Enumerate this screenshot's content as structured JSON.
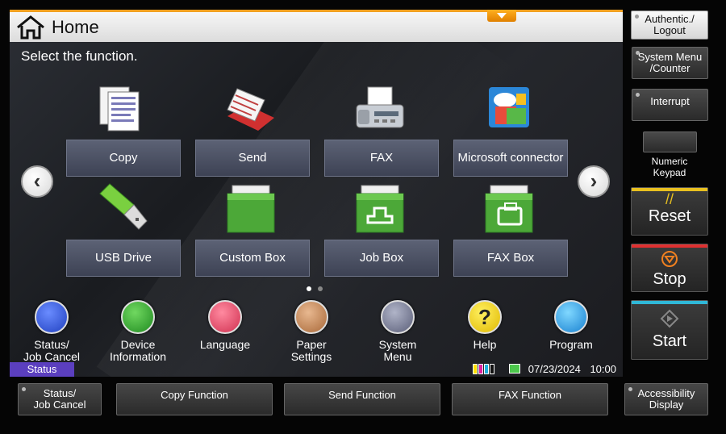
{
  "header": {
    "title": "Home"
  },
  "main": {
    "prompt": "Select the function.",
    "tiles": [
      {
        "label": "Copy"
      },
      {
        "label": "Send"
      },
      {
        "label": "FAX"
      },
      {
        "label": "Microsoft connector"
      },
      {
        "label": "USB Drive"
      },
      {
        "label": "Custom Box"
      },
      {
        "label": "Job Box"
      },
      {
        "label": "FAX Box"
      }
    ],
    "functions": [
      {
        "label": "Status/\nJob Cancel"
      },
      {
        "label": "Device\nInformation"
      },
      {
        "label": "Language"
      },
      {
        "label": "Paper\nSettings"
      },
      {
        "label": "System\nMenu"
      },
      {
        "label": "Help"
      },
      {
        "label": "Program"
      }
    ],
    "status_tab": "Status",
    "date": "07/23/2024",
    "time": "10:00"
  },
  "side": {
    "authentic": "Authentic./\nLogout",
    "system_menu": "System Menu\n/Counter",
    "interrupt": "Interrupt",
    "numeric_keypad": "Numeric\nKeypad",
    "reset": "Reset",
    "stop": "Stop",
    "start": "Start"
  },
  "bottom": {
    "status": "Status/\nJob Cancel",
    "copy_function": "Copy Function",
    "send_function": "Send Function",
    "fax_function": "FAX Function",
    "accessibility": "Accessibility\nDisplay"
  },
  "colors": {
    "accent_orange": "#f0a020",
    "status_purple": "#5b3fbf",
    "reset_yellow": "#e8c020",
    "stop_red": "#e03030",
    "start_cyan": "#30b8d8"
  }
}
